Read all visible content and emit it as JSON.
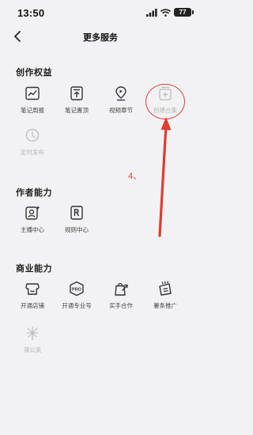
{
  "status": {
    "time": "13:50",
    "battery": "77"
  },
  "nav": {
    "title": "更多服务"
  },
  "sections": [
    {
      "title": "创作权益",
      "items": [
        {
          "label": "笔记周报",
          "icon": "weekly-report-icon",
          "enabled": true
        },
        {
          "label": "笔记置顶",
          "icon": "pin-top-icon",
          "enabled": true
        },
        {
          "label": "视频章节",
          "icon": "video-chapter-icon",
          "enabled": true
        },
        {
          "label": "创建合集",
          "icon": "collection-add-icon",
          "enabled": false
        },
        {
          "label": "定时发布",
          "icon": "scheduled-publish-icon",
          "enabled": false
        }
      ]
    },
    {
      "title": "作者能力",
      "items": [
        {
          "label": "主播中心",
          "icon": "streamer-center-icon",
          "enabled": true
        },
        {
          "label": "规则中心",
          "icon": "rules-center-icon",
          "enabled": true
        }
      ]
    },
    {
      "title": "商业能力",
      "items": [
        {
          "label": "开通店铺",
          "icon": "store-icon",
          "enabled": true
        },
        {
          "label": "开通专业号",
          "icon": "pro-account-icon",
          "enabled": true
        },
        {
          "label": "买手合作",
          "icon": "buyer-cooperation-icon",
          "enabled": true
        },
        {
          "label": "薯条推广",
          "icon": "chips-promotion-icon",
          "enabled": true
        },
        {
          "label": "蒲公英",
          "icon": "dandelion-icon",
          "enabled": false
        }
      ]
    }
  ],
  "annotation": {
    "step": "4、",
    "color": "#e23b2f"
  }
}
